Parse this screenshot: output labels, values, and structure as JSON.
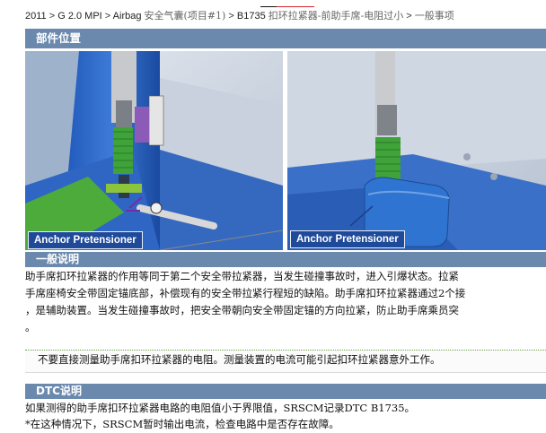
{
  "breadcrumb": {
    "year": "2011",
    "model": "G 2.0 MPI",
    "system": "Airbag",
    "system_sub": "安全气囊(项目#1)",
    "dtc": "B1735",
    "dtc_desc": "扣环拉紧器-前助手席-电阻过小",
    "section": "一般事项",
    "sep": " > "
  },
  "sections": {
    "location_title": "部件位置",
    "general_title": "一般说明",
    "dtc_title": "DTC说明"
  },
  "images": [
    {
      "caption": "Anchor Pretensioner"
    },
    {
      "caption": "Anchor Pretensioner"
    }
  ],
  "general": {
    "line1": "助手席扣环拉紧器的作用等同于第二个安全带拉紧器，当发生碰撞事故时，进入引爆状态。拉紧",
    "line2": "手席座椅安全带固定锚底部，补偿现有的安全带拉紧行程短的缺陷。助手席扣环拉紧器通过2个接",
    "line3": "，是辅助装置。当发生碰撞事故时，把安全带朝向安全带固定锚的方向拉紧，防止助手席乘员突",
    "line4": "。"
  },
  "note": "不要直接测量助手席扣环拉紧器的电阻。测量装置的电流可能引起扣环拉紧器意外工作。",
  "dtc": {
    "line1": "如果测得的助手席扣环拉紧器电路的电阻值小于界限值，SRSCM记录DTC B1735。",
    "line2": "*在这种情况下，SRSCM暂时输出电流，检查电路中是否存在故障。"
  },
  "colors": {
    "section_header": "#6b89ad",
    "caption_bg": "#1f4a9a",
    "logo_red": "#d8262c"
  }
}
